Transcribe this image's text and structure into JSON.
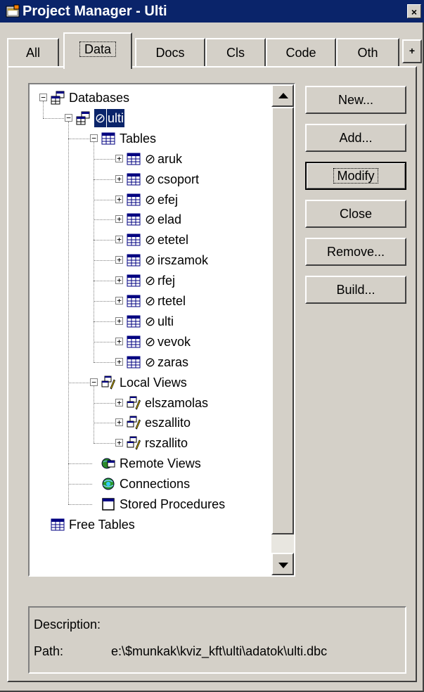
{
  "window": {
    "title": "Project Manager - Ulti",
    "close": "×"
  },
  "tabs": [
    {
      "label": "All",
      "active": false
    },
    {
      "label": "Data",
      "active": true
    },
    {
      "label": "Docs",
      "active": false
    },
    {
      "label": "Cls",
      "active": false
    },
    {
      "label": "Code",
      "active": false
    },
    {
      "label": "Oth",
      "active": false
    }
  ],
  "tab_scroll": "+",
  "tree": [
    {
      "label": "Databases",
      "level": 0,
      "expander": "−",
      "icon": "database-icon"
    },
    {
      "label": "ulti",
      "level": 1,
      "expander": "−",
      "icon": "database-icon",
      "prefix": "⊘",
      "selected": true
    },
    {
      "label": "Tables",
      "level": 2,
      "expander": "−",
      "icon": "table-icon"
    },
    {
      "label": "aruk",
      "level": 3,
      "expander": "+",
      "icon": "table-icon",
      "prefix": "⊘"
    },
    {
      "label": "csoport",
      "level": 3,
      "expander": "+",
      "icon": "table-icon",
      "prefix": "⊘"
    },
    {
      "label": "efej",
      "level": 3,
      "expander": "+",
      "icon": "table-icon",
      "prefix": "⊘"
    },
    {
      "label": "elad",
      "level": 3,
      "expander": "+",
      "icon": "table-icon",
      "prefix": "⊘"
    },
    {
      "label": "etetel",
      "level": 3,
      "expander": "+",
      "icon": "table-icon",
      "prefix": "⊘"
    },
    {
      "label": "irszamok",
      "level": 3,
      "expander": "+",
      "icon": "table-icon",
      "prefix": "⊘"
    },
    {
      "label": "rfej",
      "level": 3,
      "expander": "+",
      "icon": "table-icon",
      "prefix": "⊘"
    },
    {
      "label": "rtetel",
      "level": 3,
      "expander": "+",
      "icon": "table-icon",
      "prefix": "⊘"
    },
    {
      "label": "ulti",
      "level": 3,
      "expander": "+",
      "icon": "table-icon",
      "prefix": "⊘"
    },
    {
      "label": "vevok",
      "level": 3,
      "expander": "+",
      "icon": "table-icon",
      "prefix": "⊘"
    },
    {
      "label": "zaras",
      "level": 3,
      "expander": "+",
      "icon": "table-icon",
      "prefix": "⊘"
    },
    {
      "label": "Local Views",
      "level": 2,
      "expander": "−",
      "icon": "local-view-icon"
    },
    {
      "label": "elszamolas",
      "level": 3,
      "expander": "+",
      "icon": "local-view-icon"
    },
    {
      "label": "eszallito",
      "level": 3,
      "expander": "+",
      "icon": "local-view-icon"
    },
    {
      "label": "rszallito",
      "level": 3,
      "expander": "+",
      "icon": "local-view-icon"
    },
    {
      "label": "Remote Views",
      "level": 2,
      "expander": "",
      "icon": "remote-view-icon"
    },
    {
      "label": "Connections",
      "level": 2,
      "expander": "",
      "icon": "connections-icon"
    },
    {
      "label": "Stored Procedures",
      "level": 2,
      "expander": "",
      "icon": "stored-procedures-icon"
    },
    {
      "label": "Free Tables",
      "level": 0,
      "expander": "",
      "icon": "table-icon"
    }
  ],
  "buttons": [
    {
      "name": "new-button",
      "label": "New...",
      "default": false
    },
    {
      "name": "add-button",
      "label": "Add...",
      "default": false
    },
    {
      "name": "modify-button",
      "label": "Modify",
      "default": true
    },
    {
      "name": "close-button",
      "label": "Close",
      "default": false
    },
    {
      "name": "remove-button",
      "label": "Remove...",
      "default": false
    },
    {
      "name": "build-button",
      "label": "Build...",
      "default": false
    }
  ],
  "description": {
    "desc_label": "Description:",
    "path_label": "Path:",
    "path_value": "e:\\$munkak\\kviz_kft\\ulti\\adatok\\ulti.dbc"
  }
}
